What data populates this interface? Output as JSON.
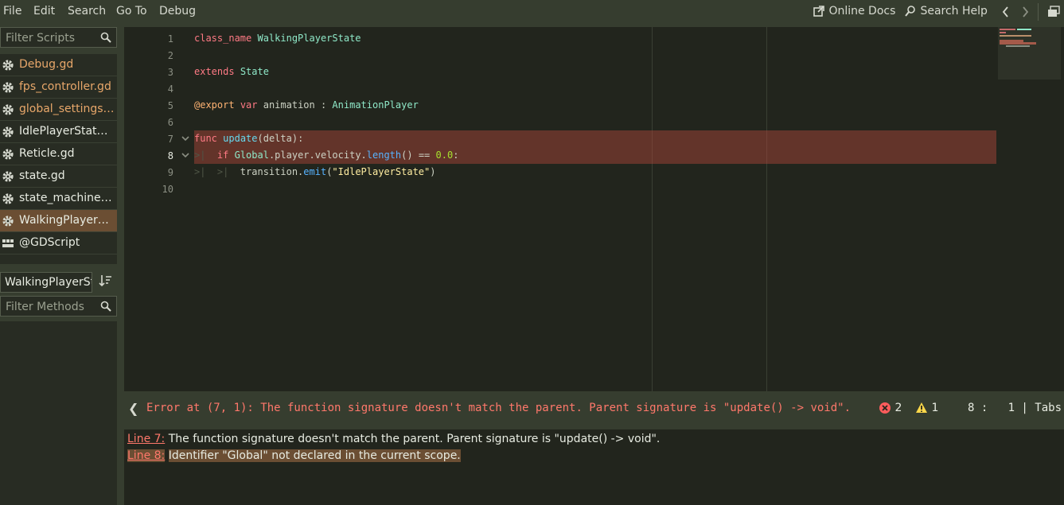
{
  "menu": [
    "File",
    "Edit",
    "Search",
    "Go To",
    "Debug"
  ],
  "toolbar": {
    "online_docs": "Online Docs",
    "search_help": "Search Help"
  },
  "scripts_filter": {
    "placeholder": "Filter Scripts"
  },
  "scripts": [
    {
      "label": "Debug.gd",
      "color": "orange"
    },
    {
      "label": "fps_controller.gd",
      "color": "orange"
    },
    {
      "label": "global_settings....",
      "color": "orange"
    },
    {
      "label": "IdlePlayerState....",
      "color": "white"
    },
    {
      "label": "Reticle.gd",
      "color": "white"
    },
    {
      "label": "state.gd",
      "color": "white"
    },
    {
      "label": "state_machine....",
      "color": "white"
    },
    {
      "label": "WalkingPlayerS...",
      "color": "white",
      "active": true
    },
    {
      "label": "@GDScript",
      "color": "white",
      "doc": true
    }
  ],
  "class_field": {
    "value": "WalkingPlayerState"
  },
  "methods_filter": {
    "placeholder": "Filter Methods"
  },
  "code": {
    "line_numbers": [
      "1",
      "2",
      "3",
      "4",
      "5",
      "6",
      "7",
      "8",
      "9",
      "10"
    ],
    "current_line": 8,
    "error_lines": [
      7,
      8
    ]
  },
  "status": {
    "message": "Error at (7, 1): The function signature doesn't match the parent. Parent signature is \"update() -> void\".",
    "errors": "2",
    "warnings": "1",
    "cursor": "8 :   1 | Tabs"
  },
  "errors_panel": [
    {
      "link": "Line 7:",
      "text": "The function signature doesn't match the parent. Parent signature is \"update() -> void\"."
    },
    {
      "link": "Line 8:",
      "text": "Identifier \"Global\" not declared in the current scope.",
      "selected": true
    }
  ],
  "colors": {
    "background": "#363d2f",
    "editor": "#22251d",
    "error": "#ff786b",
    "selection": "#6b4e33"
  }
}
